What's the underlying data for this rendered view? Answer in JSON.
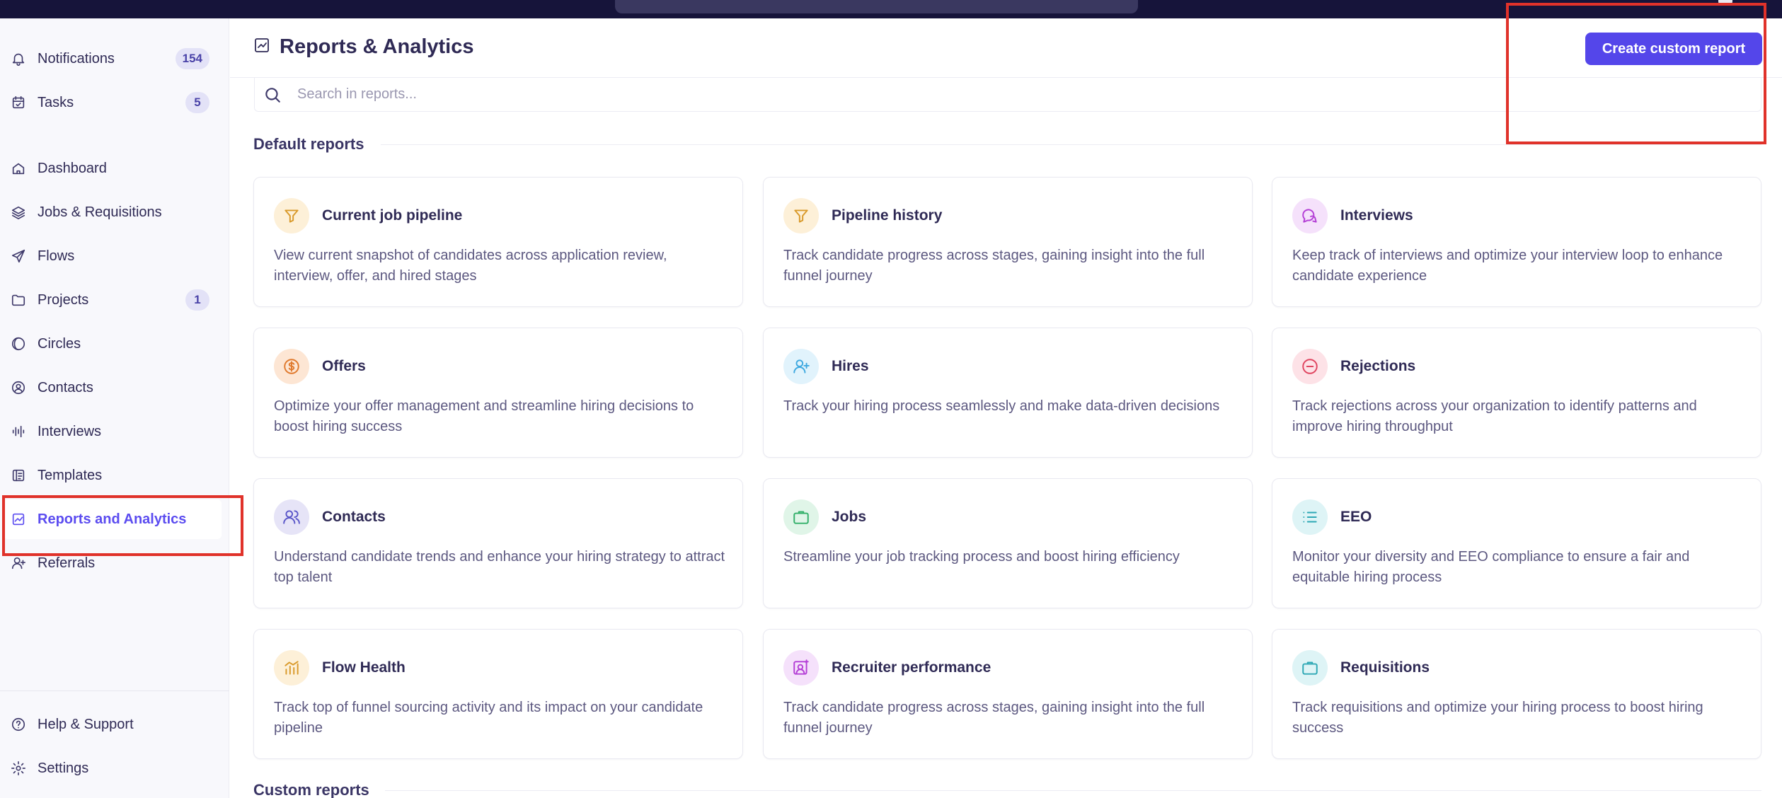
{
  "colors": {
    "accent": "#5446ea",
    "highlight": "#e0322a",
    "sidebar_bg": "#f8f8fc",
    "text": "#2f2a55"
  },
  "sidebar": {
    "top_items": [
      {
        "label": "Notifications",
        "icon": "bell-icon",
        "badge": "154"
      },
      {
        "label": "Tasks",
        "icon": "calendar-check-icon",
        "badge": "5"
      }
    ],
    "main_items": [
      {
        "label": "Dashboard",
        "icon": "home-icon"
      },
      {
        "label": "Jobs & Requisitions",
        "icon": "layers-icon"
      },
      {
        "label": "Flows",
        "icon": "send-icon"
      },
      {
        "label": "Projects",
        "icon": "folder-icon",
        "badge": "1"
      },
      {
        "label": "Circles",
        "icon": "circles-icon"
      },
      {
        "label": "Contacts",
        "icon": "user-circle-icon"
      },
      {
        "label": "Interviews",
        "icon": "waveform-icon"
      },
      {
        "label": "Templates",
        "icon": "template-icon"
      },
      {
        "label": "Reports and Analytics",
        "icon": "chart-icon",
        "active": true
      },
      {
        "label": "Referrals",
        "icon": "user-plus-icon"
      }
    ],
    "bottom_items": [
      {
        "label": "Help & Support",
        "icon": "help-icon"
      },
      {
        "label": "Settings",
        "icon": "gear-icon"
      }
    ]
  },
  "header": {
    "title": "Reports & Analytics",
    "title_icon": "chart-icon",
    "create_button": "Create custom report"
  },
  "search": {
    "placeholder": "Search in reports..."
  },
  "sections": {
    "default_title": "Default reports",
    "custom_title": "Custom reports"
  },
  "reports": [
    {
      "title": "Current job pipeline",
      "desc": "View current snapshot of candidates across application review, interview, offer, and hired stages",
      "icon": "pipeline-filter-icon",
      "icon_color": "#d99a2b",
      "icon_bg": "#fdf0d8"
    },
    {
      "title": "Pipeline history",
      "desc": "Track candidate progress across stages, gaining insight into the full funnel journey",
      "icon": "filter-icon",
      "icon_color": "#d99a2b",
      "icon_bg": "#fdf0d8"
    },
    {
      "title": "Interviews",
      "desc": "Keep track of interviews and optimize your interview loop to enhance candidate experience",
      "icon": "chat-bubbles-icon",
      "icon_color": "#b43fd6",
      "icon_bg": "#f5e1fb"
    },
    {
      "title": "Offers",
      "desc": "Optimize your offer management and streamline hiring decisions to boost hiring success",
      "icon": "dollar-icon",
      "icon_color": "#e07a2e",
      "icon_bg": "#fde6d4"
    },
    {
      "title": "Hires",
      "desc": "Track your hiring process seamlessly and make data-driven decisions",
      "icon": "user-plus-icon",
      "icon_color": "#3fa9e0",
      "icon_bg": "#e1f3fc"
    },
    {
      "title": "Rejections",
      "desc": "Track rejections across your organization to identify patterns and improve hiring throughput",
      "icon": "minus-circle-icon",
      "icon_color": "#e04560",
      "icon_bg": "#fde2e7"
    },
    {
      "title": "Contacts",
      "desc": "Understand candidate trends and enhance your hiring strategy to attract top talent",
      "icon": "users-icon",
      "icon_color": "#5b57c9",
      "icon_bg": "#e6e4f7"
    },
    {
      "title": "Jobs",
      "desc": "Streamline your job tracking process and boost hiring efficiency",
      "icon": "briefcase-icon",
      "icon_color": "#33b06a",
      "icon_bg": "#e0f5e8"
    },
    {
      "title": "EEO",
      "desc": "Monitor your diversity and EEO compliance to ensure a fair and equitable hiring process",
      "icon": "list-icon",
      "icon_color": "#2ea8b5",
      "icon_bg": "#def4f6"
    },
    {
      "title": "Flow Health",
      "desc": "Track top of funnel sourcing activity and its impact on your candidate pipeline",
      "icon": "bar-chart-icon",
      "icon_color": "#d99a2b",
      "icon_bg": "#fdf0d8"
    },
    {
      "title": "Recruiter performance",
      "desc": "Track candidate progress across stages, gaining insight into the full funnel journey",
      "icon": "person-sparkle-icon",
      "icon_color": "#b43fd6",
      "icon_bg": "#f5e1fb"
    },
    {
      "title": "Requisitions",
      "desc": "Track requisitions and optimize your hiring process to boost hiring success",
      "icon": "briefcase-icon",
      "icon_color": "#2ea8b5",
      "icon_bg": "#def4f6"
    }
  ]
}
